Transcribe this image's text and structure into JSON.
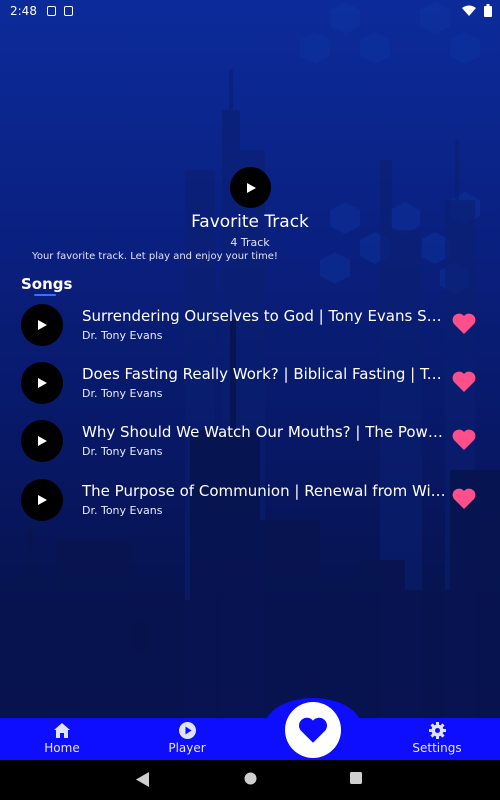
{
  "status": {
    "time": "2:48"
  },
  "hero": {
    "title": "Favorite Track",
    "count": "4 Track",
    "description": "Your favorite track. Let play and enjoy your time!"
  },
  "songs_label": "Songs",
  "songs": [
    {
      "title": "Surrendering Ourselves to God | Tony Evans Sermon",
      "artist": "Dr. Tony Evans"
    },
    {
      "title": "Does Fasting Really Work? | Biblical Fasting | Tony Evans",
      "artist": "Dr. Tony Evans"
    },
    {
      "title": "Why Should We Watch Our Mouths? | The Power of Words",
      "artist": "Dr. Tony Evans"
    },
    {
      "title": "The Purpose of Communion | Renewal from Within",
      "artist": "Dr. Tony Evans"
    }
  ],
  "nav": {
    "home": "Home",
    "player": "Player",
    "settings": "Settings"
  },
  "colors": {
    "accent": "#0d0dff",
    "heart": "#ff4f8b"
  }
}
